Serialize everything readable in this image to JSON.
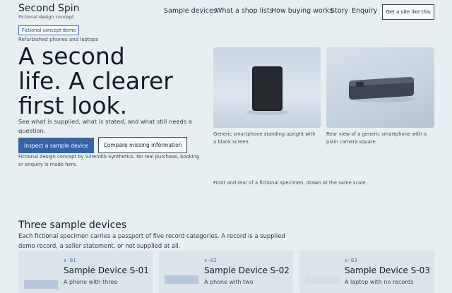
{
  "header": {
    "brand": "Second Spin",
    "tagline": "Fictional design concept",
    "nav": [
      "Sample devices",
      "What a shop lists",
      "How buying works",
      "Story",
      "Enquiry"
    ],
    "cta": "Get a site like this"
  },
  "hero": {
    "badge": "Fictional concept demo",
    "eyebrow": "Refurbished phones and laptops",
    "title_lines": [
      "A second",
      "life. A clearer",
      "first look."
    ],
    "lede": "See what is supplied, what is stated, and what still needs a question.",
    "primary_button": "Inspect a sample device",
    "secondary_button": "Compare missing information",
    "disclaimer": "Fictional design concept by S3rendib Synthetics. No real purchase, booking or enquiry is made here."
  },
  "gallery": {
    "front_caption": "Generic smartphone standing upright with a blank screen",
    "rear_caption": "Rear view of a generic smartphone with a plain camera square",
    "scale_note": "Front and rear of a fictional specimen, drawn at the same scale."
  },
  "devices_section": {
    "title": "Three sample devices",
    "lede": "Each fictional specimen carries a passport of five record categories. A record is a supplied demo record, a seller statement, or not supplied at all.",
    "cards": [
      {
        "code": "S-01",
        "title": "Sample Device S-01",
        "desc": "A phone with three"
      },
      {
        "code": "S-02",
        "title": "Sample Device S-02",
        "desc": "A phone with two"
      },
      {
        "code": "S-03",
        "title": "Sample Device S-03",
        "desc": "A laptop with no records"
      }
    ]
  },
  "colors": {
    "background": "#e8eff2",
    "accent": "#3563a8",
    "text": "#111c26"
  }
}
